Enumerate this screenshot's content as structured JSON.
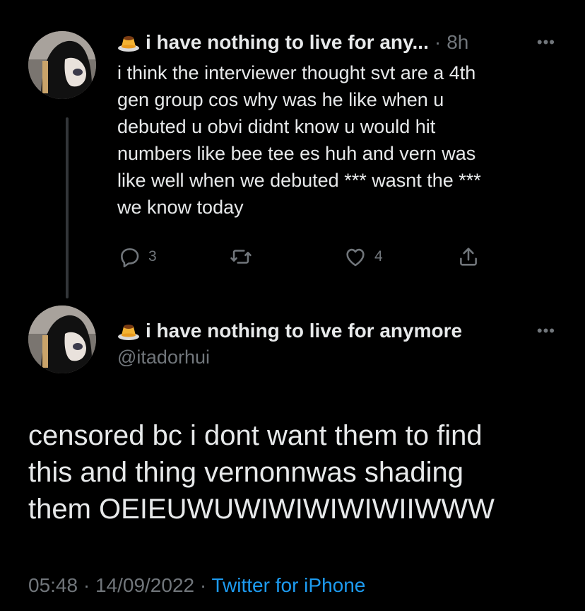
{
  "reply_tweet": {
    "author_name": "i have nothing to live for any...",
    "time": "8h",
    "separator": "·",
    "more": "•••",
    "text": "i think the interviewer thought svt are a 4th\ngen group cos why was he like when u\ndebuted u obvi didnt know u would hit\nnumbers like bee tee es huh and vern was\nlike well when we debuted *** wasnt the ***\nwe know today",
    "actions": {
      "reply_count": "3",
      "like_count": "4",
      "reply_icon": "reply-icon",
      "retweet_icon": "retweet-icon",
      "like_icon": "heart-icon",
      "share_icon": "share-icon"
    }
  },
  "main_tweet": {
    "author_name": "i have nothing to live for anymore",
    "handle": "@itadorhui",
    "more": "•••",
    "text": "censored bc i dont want them to find\nthis and thing vernonnwas shading\nthem OEIEUWUWIWIWIWIWIIWWW",
    "timestamp": "05:48 · 14/09/2022 ·",
    "source": "Twitter for iPhone"
  },
  "colors": {
    "background": "#000000",
    "text": "#e7e9ea",
    "secondary": "#71767b",
    "link": "#1d9bf0"
  }
}
